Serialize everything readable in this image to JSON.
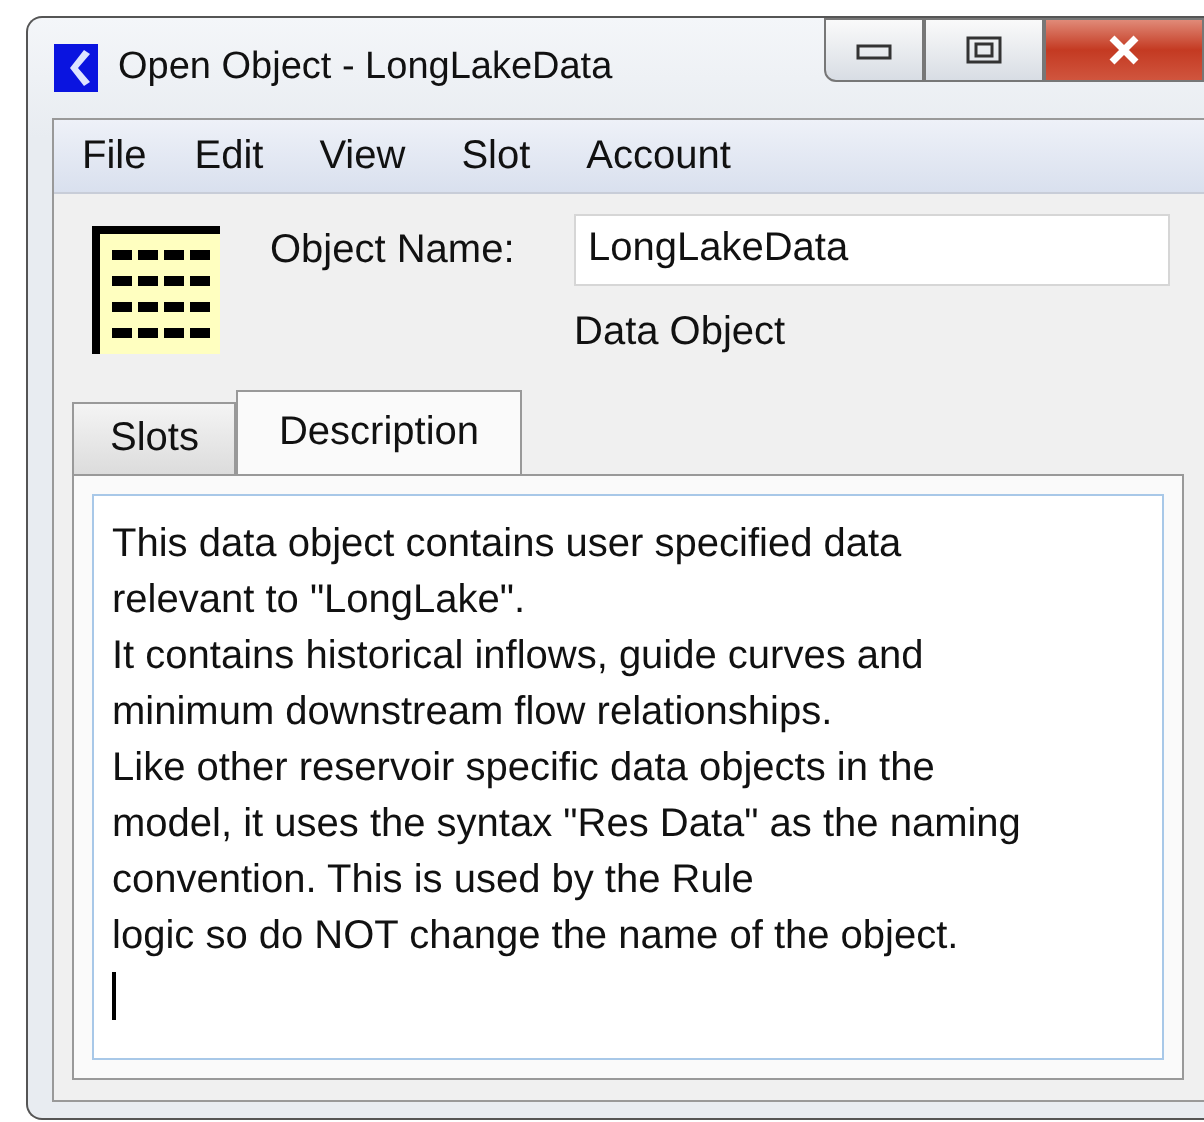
{
  "window": {
    "title": "Open Object - LongLakeData"
  },
  "menu": [
    "File",
    "Edit",
    "View",
    "Slot",
    "Account"
  ],
  "object": {
    "label": "Object Name:",
    "name": "LongLakeData",
    "type": "Data Object"
  },
  "tabs": [
    {
      "label": "Slots",
      "selected": false
    },
    {
      "label": "Description",
      "selected": true
    }
  ],
  "description": {
    "lines": [
      "This data object contains user specified data",
      "relevant to \"LongLake\".",
      "It contains historical inflows, guide curves and",
      "minimum downstream flow relationships.",
      "Like other reservoir specific data objects in the",
      "model, it uses the syntax \"Res Data\" as the naming",
      "convention. This is used by the Rule",
      "logic so do NOT change the name of the object."
    ]
  }
}
